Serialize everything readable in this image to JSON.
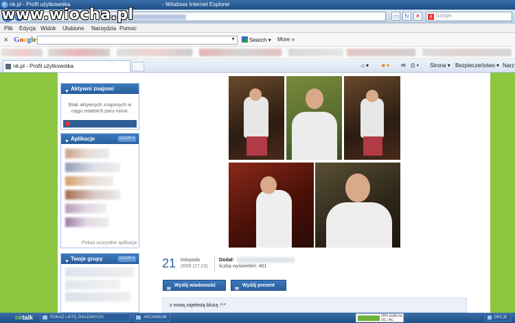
{
  "window": {
    "title": "nk.pl - Profil użytkownika",
    "app": "- Windows Internet Explorer"
  },
  "watermark": "www.wiocha.pl",
  "address_bar": {
    "search_placeholder": "Google"
  },
  "menu": [
    "Plik",
    "Edycja",
    "Widok",
    "Ulubione",
    "Narzędzia",
    "Pomoc"
  ],
  "google_toolbar": {
    "logo_letters": [
      "G",
      "o",
      "o",
      "g",
      "l",
      "e"
    ],
    "search_label": "Search",
    "more_label": "More »"
  },
  "tab": {
    "label": "nk.pl - Profil użytkownika"
  },
  "command_bar": {
    "strona": "Strona ▾",
    "bezpieczenstwo": "Bezpieczeństwo ▾",
    "narzedzia": "Narz"
  },
  "sidebar": {
    "active_friends": {
      "title": "Aktywni znajomi",
      "message": "Brak aktywnych znajomych w ciągu ostatnich paru minut."
    },
    "apps": {
      "title": "Aplikacje",
      "toggle": "rozwiń ▾",
      "show_all": "Pokaż wszystkie aplikacje"
    },
    "groups": {
      "title": "Twoje grupy",
      "toggle": "rozwiń ▾"
    }
  },
  "photo_info": {
    "day": "21",
    "month": "listopada",
    "date_time": "2009 (17:15)",
    "added_by_label": "Dodał:",
    "views_label": "liczba wyświetleń:",
    "views_count": "461"
  },
  "actions": {
    "send_message": "Wyślij wiadomość",
    "send_gift": "Wyślij prezent"
  },
  "comment": "z nową zajebistą bluzą :*:*",
  "nk_bar": {
    "logo_prefix": "nk",
    "logo_suffix": "talk",
    "show_friends": "POKAŻ LISTĘ ZNAJOMYCH",
    "archive": "ARCHIWUM",
    "ad_text": "15% zniżki na OC i AC",
    "options": "OPCJE"
  },
  "colors": {
    "page_background": "#8dc63f",
    "header_blue": "#2a5e9c",
    "ie_titlebar": "#1d4f87"
  }
}
